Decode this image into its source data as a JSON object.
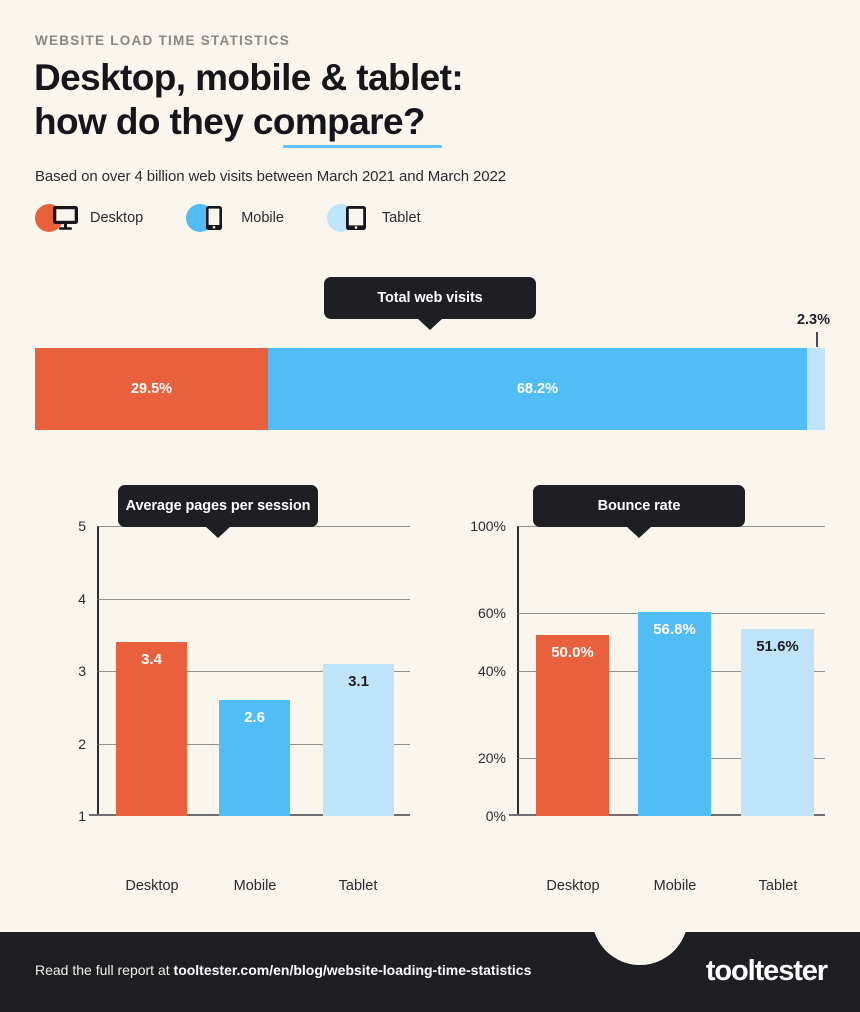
{
  "header": {
    "kicker": "WEBSITE LOAD TIME STATISTICS",
    "headline": "Desktop, mobile & tablet:\nhow do they compare?",
    "subhead": "Based on over 4 billion web visits between March 2021 and March 2022"
  },
  "legend": {
    "items": [
      {
        "label": "Desktop",
        "color": "#e8613c",
        "icon": "desktop-monitor-icon"
      },
      {
        "label": "Mobile",
        "color": "#52bcf5",
        "icon": "mobile-phone-icon"
      },
      {
        "label": "Tablet",
        "color": "#bfe3f8",
        "icon": "tablet-icon"
      }
    ]
  },
  "colors": {
    "background": "#faf6ee",
    "desktop": "#e8613c",
    "mobile": "#52bcf5",
    "tablet": "#bfe3f8",
    "dark": "#1e1e23",
    "accent_underline": "#62c2f5"
  },
  "footer": {
    "lead": "Read the full report at ",
    "url": "tooltester.com/en/blog/website-loading-time-statistics",
    "logo": "tooltester"
  },
  "chart_data": [
    {
      "type": "bar",
      "title": "Total web visits",
      "orientation": "horizontal-stacked",
      "categories": [
        "Desktop",
        "Mobile",
        "Tablet"
      ],
      "values": [
        29.5,
        68.2,
        2.3
      ],
      "labels": [
        "29.5%",
        "68.2%",
        "2.3%"
      ],
      "unit": "%",
      "xlabel": "",
      "ylabel": "",
      "legend": "top",
      "grid": false,
      "annotations": [
        "2.3%"
      ]
    },
    {
      "type": "bar",
      "title": "Average pages per session",
      "categories": [
        "Desktop",
        "Mobile",
        "Tablet"
      ],
      "values": [
        3.4,
        2.6,
        3.1
      ],
      "labels": [
        "3.4",
        "2.6",
        "3.1"
      ],
      "xlabel": "",
      "ylabel": "",
      "ylim": [
        1,
        5
      ],
      "yticks": [
        1,
        2,
        3,
        4,
        5
      ],
      "ytick_labels": [
        "1",
        "2",
        "3",
        "4",
        "5"
      ],
      "grid": true,
      "legend": "none"
    },
    {
      "type": "bar",
      "title": "Bounce rate",
      "categories": [
        "Desktop",
        "Mobile",
        "Tablet"
      ],
      "values": [
        50.0,
        56.8,
        51.6
      ],
      "labels": [
        "50.0%",
        "56.8%",
        "51.6%"
      ],
      "xlabel": "",
      "ylabel": "",
      "unit": "%",
      "ylim": [
        0,
        100
      ],
      "yticks": [
        0,
        20,
        40,
        60,
        100
      ],
      "ytick_labels": [
        "0%",
        "20%",
        "40%",
        "60%",
        "100%"
      ],
      "grid": true,
      "legend": "none"
    }
  ]
}
